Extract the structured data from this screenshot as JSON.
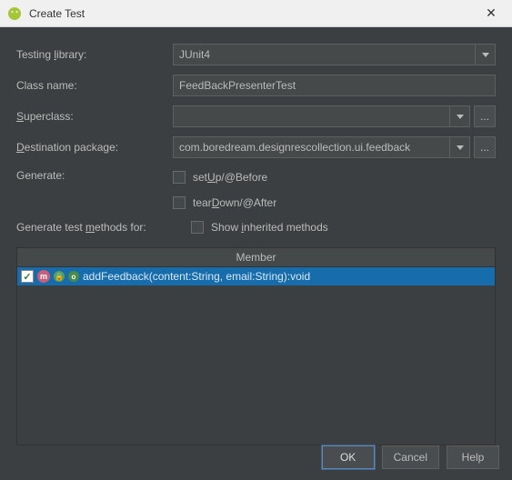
{
  "titlebar": {
    "title": "Create Test",
    "close_glyph": "✕"
  },
  "form": {
    "testing_library_label": "Testing library:",
    "testing_library_value": "JUnit4",
    "class_name_label": "Class name:",
    "class_name_value": "FeedBackPresenterTest",
    "superclass_label": "Superclass:",
    "superclass_value": "",
    "destination_label": "Destination package:",
    "destination_value": "com.boredream.designrescollection.ui.feedback",
    "ellipsis": "...",
    "generate_label": "Generate:",
    "setup_label_pre": "set",
    "setup_label_u": "U",
    "setup_label_post": "p/@Before",
    "teardown_label_pre": "tear",
    "teardown_label_u": "D",
    "teardown_label_post": "own/@After",
    "methods_label_pre": "Generate test ",
    "methods_label_u": "m",
    "methods_label_post": "ethods for:",
    "show_inherited_label_pre": "Show ",
    "show_inherited_label_u": "i",
    "show_inherited_label_post": "nherited methods"
  },
  "table": {
    "header": "Member",
    "rows": [
      {
        "checked": true,
        "text": "addFeedback(content:String, email:String):void"
      }
    ]
  },
  "buttons": {
    "ok": "OK",
    "cancel": "Cancel",
    "help": "Help"
  }
}
